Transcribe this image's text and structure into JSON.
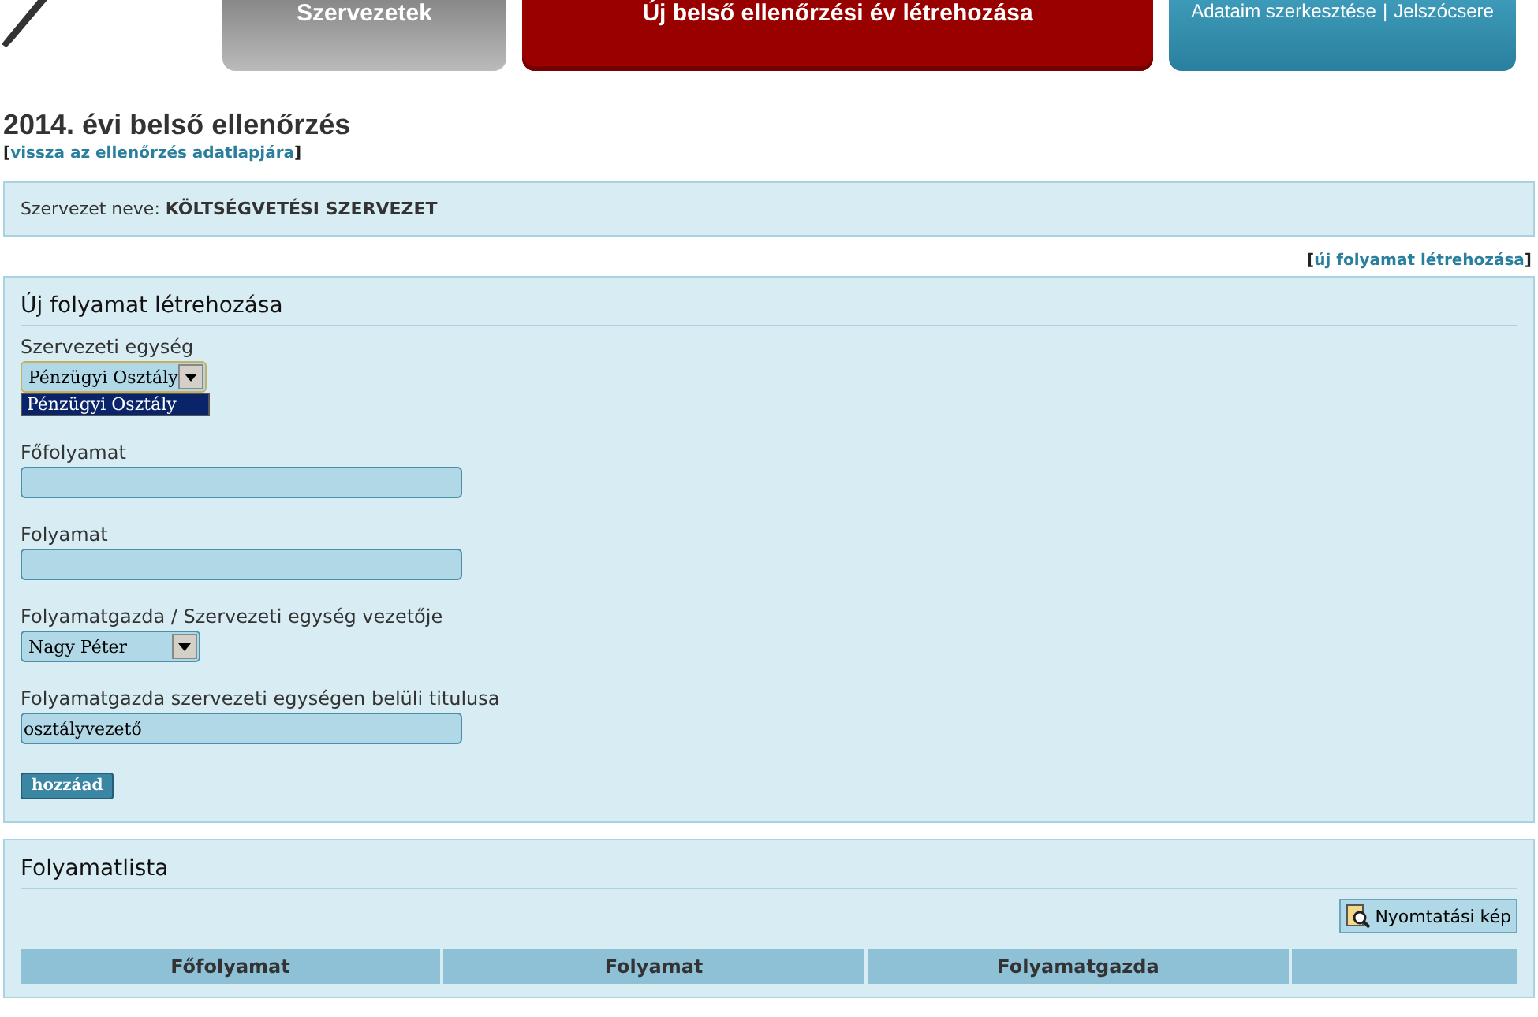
{
  "header": {
    "tabs": [
      {
        "label": "Szervezetek",
        "kind": "grey",
        "selected": false
      },
      {
        "label": "Új belső ellenőrzési év létrehozása",
        "kind": "red",
        "selected": true
      }
    ],
    "user_links": [
      "Adataim szerkesztése",
      "Jelszócsere"
    ],
    "separator": "|"
  },
  "title": "2014. évi belső ellenőrzés",
  "back_link": {
    "open": "[",
    "label": "vissza az ellenőrzés adatlapjára",
    "close": "]"
  },
  "org": {
    "label": "Szervezet neve:",
    "value": "KÖLTSÉGVETÉSI SZERVEZET"
  },
  "new_link": {
    "open": "[",
    "label": "új folyamat létrehozása",
    "close": "]"
  },
  "form": {
    "title": "Új folyamat létrehozása",
    "fields": [
      {
        "kind": "select",
        "label": "Szervezeti egység",
        "value": "Pénzügyi Osztály",
        "expanded": true,
        "options": [
          {
            "label": "Pénzügyi Osztály",
            "selected": true
          }
        ]
      },
      {
        "kind": "text",
        "label": "Főfolyamat"
      },
      {
        "kind": "text",
        "label": "Folyamat"
      },
      {
        "kind": "select",
        "label": "Folyamatgazda / Szervezeti egység vezetője",
        "value": "Nagy Péter",
        "expanded": false
      },
      {
        "kind": "text",
        "label": "Folyamatgazda szervezeti egységen belüli titulusa",
        "value": "osztályvezető"
      }
    ],
    "submit": "hozzáad"
  },
  "list": {
    "title": "Folyamatlista",
    "print_button": "Nyomtatási kép",
    "columns": [
      "Főfolyamat",
      "Folyamat",
      "Folyamatgazda"
    ]
  }
}
